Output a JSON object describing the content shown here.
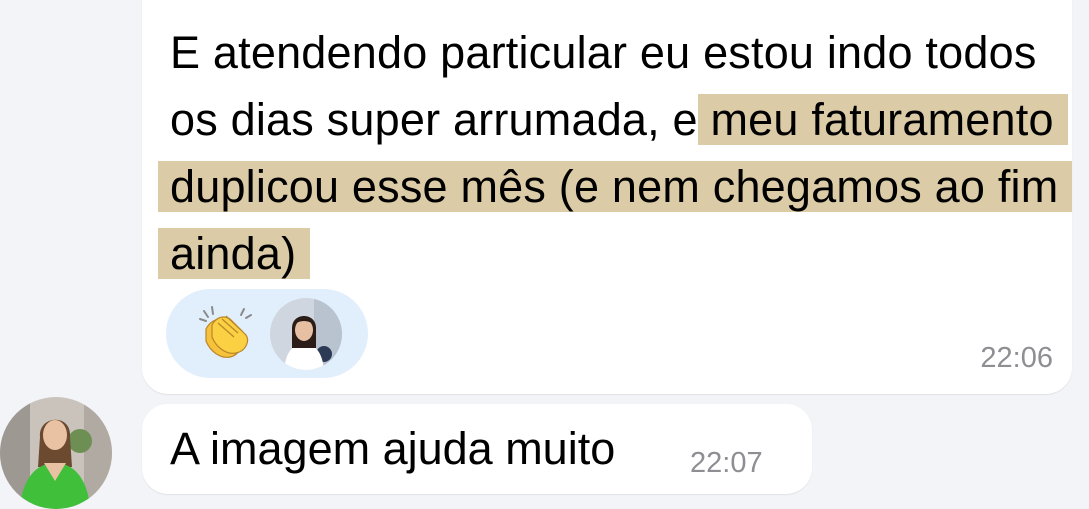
{
  "messages": [
    {
      "text_plain": "E atendendo particular eu estou indo todos os dias super arrumada, e",
      "text_highlight": "meu faturamento duplicou esse mês (e nem chegamos ao fim ainda)",
      "time": "22:06",
      "reactions": [
        "clapping-hands-icon",
        "reactor-avatar"
      ],
      "highlight_color": "#dccba7"
    },
    {
      "text": "A imagem ajuda muito",
      "time": "22:07"
    }
  ],
  "colors": {
    "background": "#f3f4f8",
    "bubble": "#ffffff",
    "reaction_pill": "#e1eefc",
    "timestamp": "#8e8e93"
  }
}
